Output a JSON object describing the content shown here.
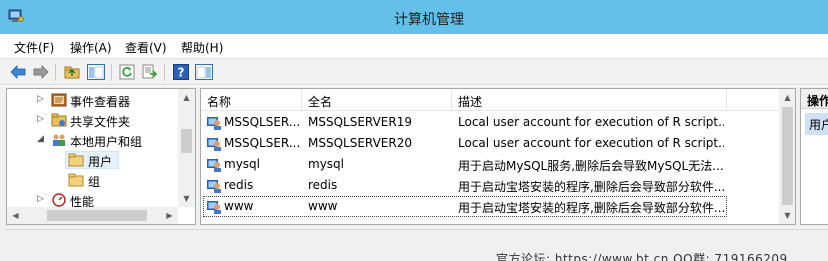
{
  "window": {
    "title": "计算机管理"
  },
  "menu": [
    "文件(F)",
    "操作(A)",
    "查看(V)",
    "帮助(H)"
  ],
  "toolbar": {
    "icons": [
      "back-arrow-icon",
      "forward-arrow-icon",
      "up-folder-icon",
      "show-hide-tree-icon",
      "refresh-icon",
      "export-list-icon",
      "help-icon",
      "show-hide-action-pane-icon"
    ]
  },
  "tree": {
    "items": [
      {
        "label": "事件查看器",
        "expander": "▷",
        "icon": "event-viewer-icon"
      },
      {
        "label": "共享文件夹",
        "expander": "▷",
        "icon": "shared-folder-icon"
      },
      {
        "label": "本地用户和组",
        "expander": "◢",
        "icon": "local-users-groups-icon"
      },
      {
        "label": "用户",
        "expander": "",
        "icon": "folder-icon"
      },
      {
        "label": "组",
        "expander": "",
        "icon": "folder-icon"
      },
      {
        "label": "性能",
        "expander": "▷",
        "icon": "performance-icon"
      }
    ]
  },
  "list": {
    "columns": [
      "名称",
      "全名",
      "描述"
    ],
    "rows": [
      {
        "name": "MSSQLSER...",
        "full_name": "MSSQLSERVER19",
        "description": "Local user account for execution of R script..."
      },
      {
        "name": "MSSQLSER...",
        "full_name": "MSSQLSERVER20",
        "description": "Local user account for execution of R script..."
      },
      {
        "name": "mysql",
        "full_name": "mysql",
        "description": "用于启动MySQL服务,删除后会导致MySQL无法..."
      },
      {
        "name": "redis",
        "full_name": "redis",
        "description": "用于启动宝塔安装的程序,删除后会导致部分软件..."
      },
      {
        "name": "www",
        "full_name": "www",
        "description": "用于启动宝塔安装的程序,删除后会导致部分软件..."
      }
    ]
  },
  "actions": {
    "header": "操作",
    "item": "用户"
  },
  "watermark": "官方论坛: https://www.bt.cn  QQ群: 719166209",
  "colors": {
    "titlebar": "#63c1e9",
    "selection": "#cfe1f5"
  }
}
